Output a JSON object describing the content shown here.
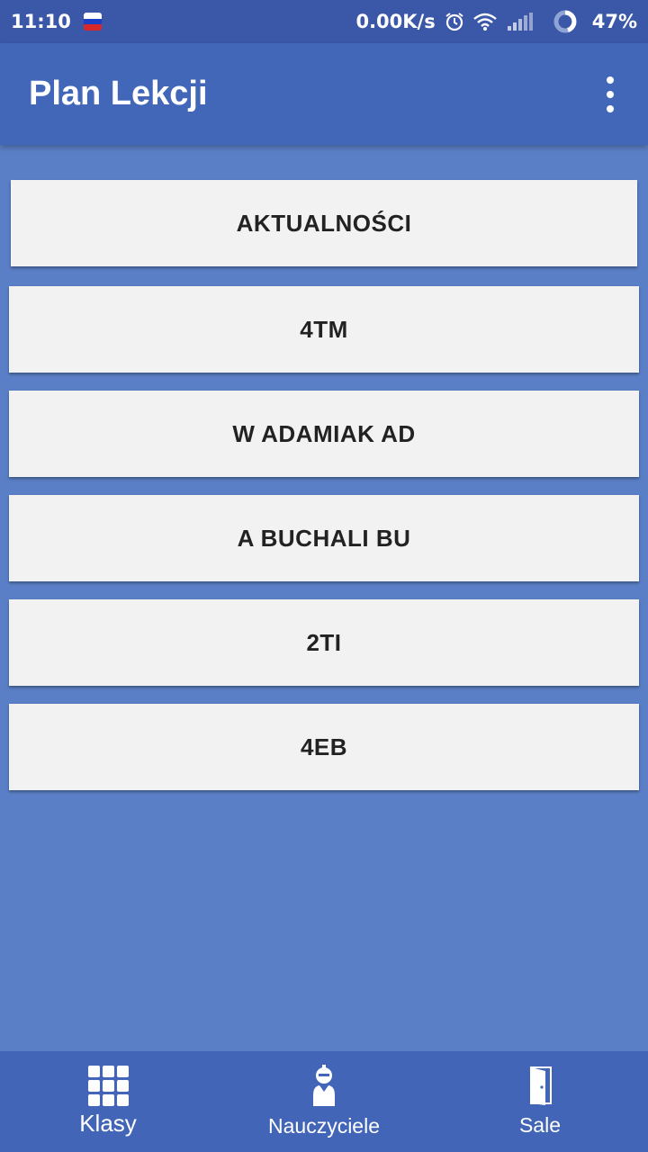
{
  "status": {
    "time": "11:10",
    "speed": "0.00K/s",
    "battery": "47%"
  },
  "app": {
    "title": "Plan Lekcji"
  },
  "list": [
    {
      "label": "AKTUALNOŚCI"
    },
    {
      "label": "4TM"
    },
    {
      "label": "W ADAMIAK AD"
    },
    {
      "label": "A BUCHALI BU"
    },
    {
      "label": "2TI"
    },
    {
      "label": "4EB"
    }
  ],
  "nav": [
    {
      "label": "Klasy",
      "icon": "grid-icon"
    },
    {
      "label": "Nauczyciele",
      "icon": "teacher-icon"
    },
    {
      "label": "Sale",
      "icon": "door-icon"
    }
  ],
  "colors": {
    "background": "#5b7fc6",
    "appbar": "#4267b8",
    "statusbar": "#3b57a8",
    "bottomnav": "#4265b7",
    "button": "#f2f2f2"
  }
}
